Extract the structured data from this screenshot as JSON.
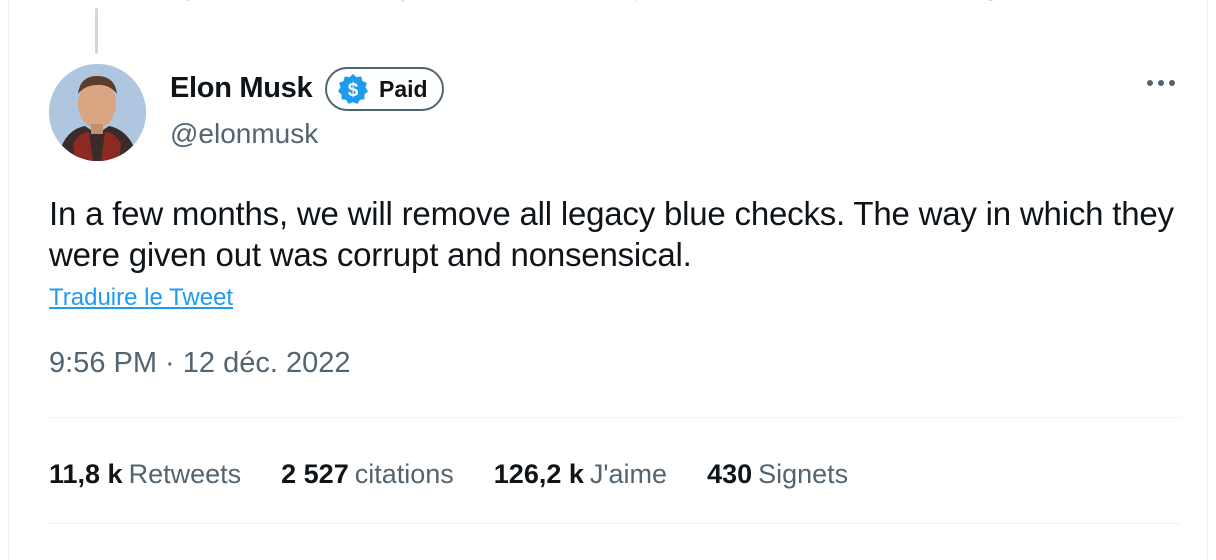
{
  "tweet": {
    "author_name": "Elon Musk",
    "author_handle": "@elonmusk",
    "badge_label": "Paid",
    "badge_icon": "dollar-verified-icon",
    "text": "In a few months, we will remove all legacy blue checks. The way in which they were given out was corrupt and nonsensical.",
    "translate_link": "Traduire le Tweet",
    "timestamp": "9:56 PM · 12 déc. 2022",
    "more_icon": "more-options-icon"
  },
  "stats": [
    {
      "value": "11,8 k",
      "label": "Retweets"
    },
    {
      "value": "2 527",
      "label": "citations"
    },
    {
      "value": "126,2 k",
      "label": "J'aime"
    },
    {
      "value": "430",
      "label": "Signets"
    }
  ],
  "colors": {
    "text_primary": "#0f1419",
    "text_secondary": "#536471",
    "link": "#1d9bf0",
    "badge_fill": "#1d9bf0",
    "border": "#eff3f4"
  }
}
